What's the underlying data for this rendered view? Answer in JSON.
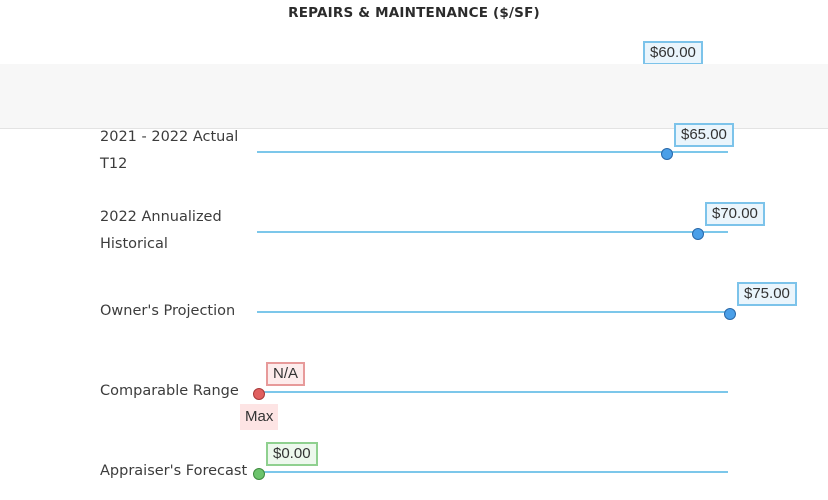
{
  "title": "REPAIRS & MAINTENANCE ($/SF)",
  "top_badge": "$60.00",
  "rows": [
    {
      "label_line1": "2021 - 2022 Actual",
      "label_line2": "T12",
      "value_label": "$65.00",
      "color": "#4a9fe8"
    },
    {
      "label_line1": "2022 Annualized",
      "label_line2": "Historical",
      "value_label": "$70.00",
      "color": "#4a9fe8"
    },
    {
      "label_line1": "Owner's Projection",
      "value_label": "$75.00",
      "color": "#4a9fe8"
    },
    {
      "label_line1": "Comparable Range",
      "value_label": "N/A",
      "secondary_label": "Max",
      "color": "#e06060"
    },
    {
      "label_line1": "Appraiser's Forecast",
      "value_label": "$0.00",
      "color": "#6cc36c"
    }
  ]
}
